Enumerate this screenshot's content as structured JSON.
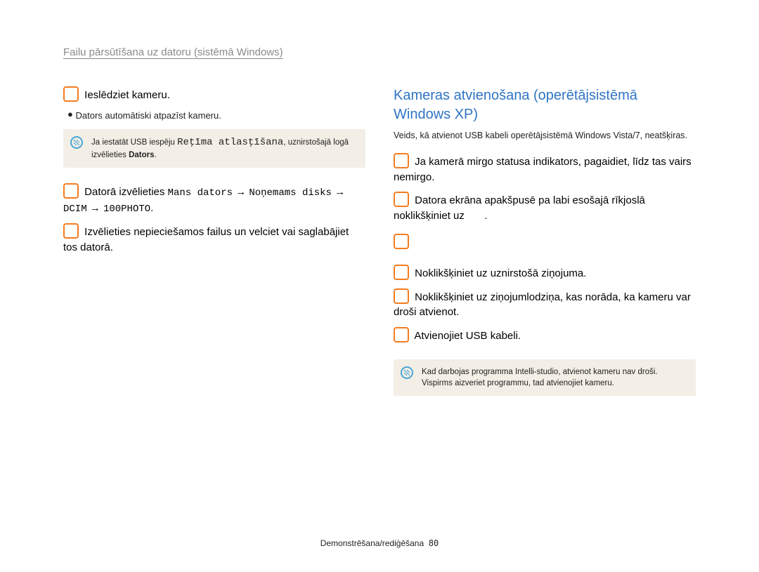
{
  "header": {
    "section_title": "Failu pārsūtīšana uz datoru (sistēmā Windows)"
  },
  "left": {
    "step3_text": "Ieslēdziet kameru.",
    "step3_bullet": "Dators automātiski atpazīst kameru.",
    "note1_line_a": "Ja iestatāt USB iespēju ",
    "note1_mono": "Reţīma atlasţīšana",
    "note1_line_b": ", uznirstošajā logā izvēlieties ",
    "note1_bold": "Dators",
    "note1_end": ".",
    "step4_prefix": "Datorā izvēlieties ",
    "step4_path1": "Mans dators",
    "step4_path2": "Noņemams disks",
    "step4_path3": "DCIM",
    "step4_path4": "100PHOTO",
    "step4_end": ".",
    "step5_text": "Izvēlieties nepieciešamos failus un velciet vai saglabājiet tos datorā."
  },
  "right": {
    "title": "Kameras atvienošana (operētājsistēmā Windows XP)",
    "subnote": "Veids, kā atvienot USB kabeli operētājsistēmā Windows Vista/7, neatšķiras.",
    "step1_text": "Ja kamerā mirgo statusa indikators, pagaidiet, līdz tas vairs nemirgo.",
    "step2_text_a": "Datora ekrāna apakšpusē pa labi esošajā rīkjoslā noklikšķiniet uz ",
    "step2_text_b": ".",
    "step3_text": "Noklikšķiniet uz uznirstošā ziņojuma.",
    "step4_text": "Noklikšķiniet uz ziņojumlodziņa, kas norāda, ka kameru var droši atvienot.",
    "step5_text": "Atvienojiet USB kabeli.",
    "note2_line1": "Kad darbojas programma Intelli-studio, atvienot kameru nav droši.",
    "note2_line2": "Vispirms aizveriet programmu, tad atvienojiet kameru."
  },
  "footer": {
    "label": "Demonstrēšana/rediģēšana",
    "page": "80"
  }
}
